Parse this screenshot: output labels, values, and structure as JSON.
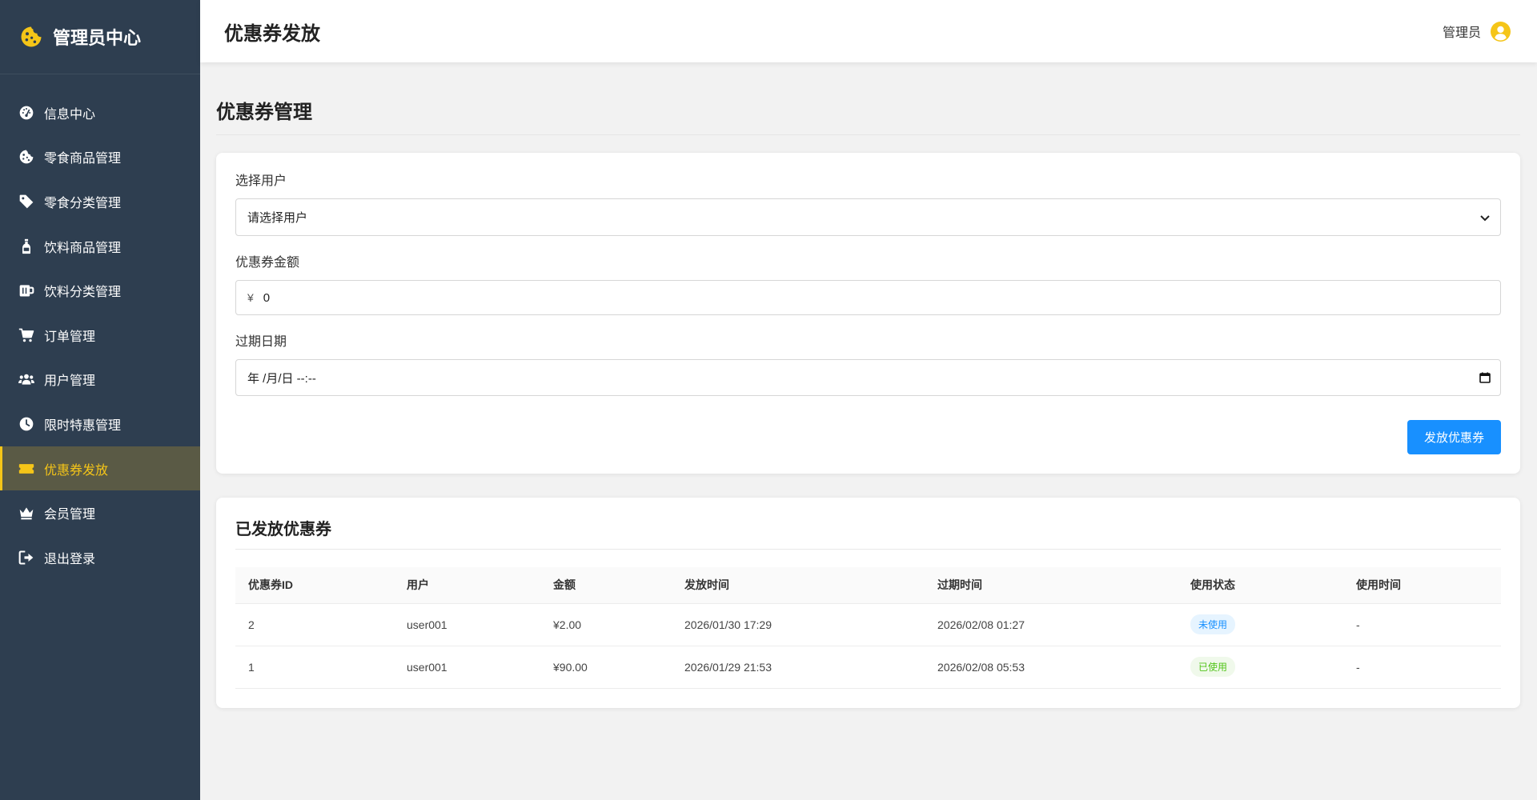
{
  "sidebar": {
    "logo_icon": "cookie-icon",
    "title": "管理员中心",
    "active_index": 8,
    "items": [
      {
        "label": "信息中心",
        "icon": "dashboard-icon"
      },
      {
        "label": "零食商品管理",
        "icon": "cookie-icon"
      },
      {
        "label": "零食分类管理",
        "icon": "tag-icon"
      },
      {
        "label": "饮料商品管理",
        "icon": "bottle-icon"
      },
      {
        "label": "饮料分类管理",
        "icon": "mug-icon"
      },
      {
        "label": "订单管理",
        "icon": "cart-icon"
      },
      {
        "label": "用户管理",
        "icon": "users-icon"
      },
      {
        "label": "限时特惠管理",
        "icon": "clock-icon"
      },
      {
        "label": "优惠券发放",
        "icon": "ticket-icon"
      },
      {
        "label": "会员管理",
        "icon": "crown-icon"
      },
      {
        "label": "退出登录",
        "icon": "sign-out-icon"
      }
    ]
  },
  "header": {
    "title": "优惠券发放",
    "user_name": "管理员",
    "user_icon": "user-circle-icon"
  },
  "form": {
    "section_title": "优惠券管理",
    "user_label": "选择用户",
    "user_select_value": "请选择用户",
    "amount_label": "优惠券金额",
    "amount_prefix": "¥",
    "amount_value": "0",
    "date_label": "过期日期",
    "date_value": "年 /月/日 --:--",
    "submit_label": "发放优惠券"
  },
  "table": {
    "title": "已发放优惠券",
    "columns": [
      "优惠券ID",
      "用户",
      "金额",
      "发放时间",
      "过期时间",
      "使用状态",
      "使用时间"
    ],
    "rows": [
      {
        "id": "2",
        "user": "user001",
        "amount": "¥2.00",
        "issued": "2026/01/30 17:29",
        "expires": "2026/02/08 01:27",
        "status": "未使用",
        "status_type": "unused",
        "used_at": "-"
      },
      {
        "id": "1",
        "user": "user001",
        "amount": "¥90.00",
        "issued": "2026/01/29 21:53",
        "expires": "2026/02/08 05:53",
        "status": "已使用",
        "status_type": "used",
        "used_at": "-"
      }
    ]
  },
  "colors": {
    "sidebar_bg": "#2e3e50",
    "accent_yellow": "#f5c518",
    "primary_blue": "#1890ff",
    "success_green": "#52c41a"
  }
}
